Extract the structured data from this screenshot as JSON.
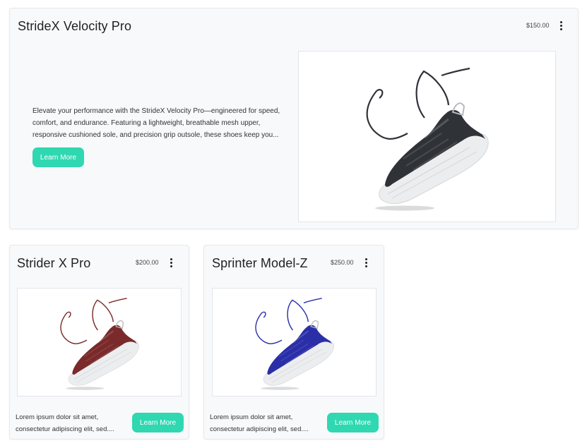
{
  "featured": {
    "title": "StrideX Velocity Pro",
    "price": "$150.00",
    "description": "Elevate your performance with the StrideX Velocity Pro—engineered for speed, comfort, and endurance. Featuring a lightweight, breathable mesh upper, responsive cushioned sole, and precision grip outsole, these shoes keep you...",
    "button_label": "Learn More",
    "shoe_color": "#2f3237",
    "image_icon": "sneaker-image"
  },
  "products": [
    {
      "title": "Strider X Pro",
      "price": "$200.00",
      "description": "Lorem ipsum dolor sit amet, consectetur adipiscing elit, sed....",
      "button_label": "Learn More",
      "shoe_color": "#7a2a2a",
      "image_icon": "sneaker-image"
    },
    {
      "title": "Sprinter Model-Z",
      "price": "$250.00",
      "description": "Lorem ipsum dolor sit amet, consectetur adipiscing elit, sed....",
      "button_label": "Learn More",
      "shoe_color": "#2a2fa8",
      "image_icon": "sneaker-image"
    }
  ],
  "colors": {
    "accent": "#2fd8b1",
    "card_bg": "#f8f9fb",
    "card_border": "#e6e8ec"
  }
}
